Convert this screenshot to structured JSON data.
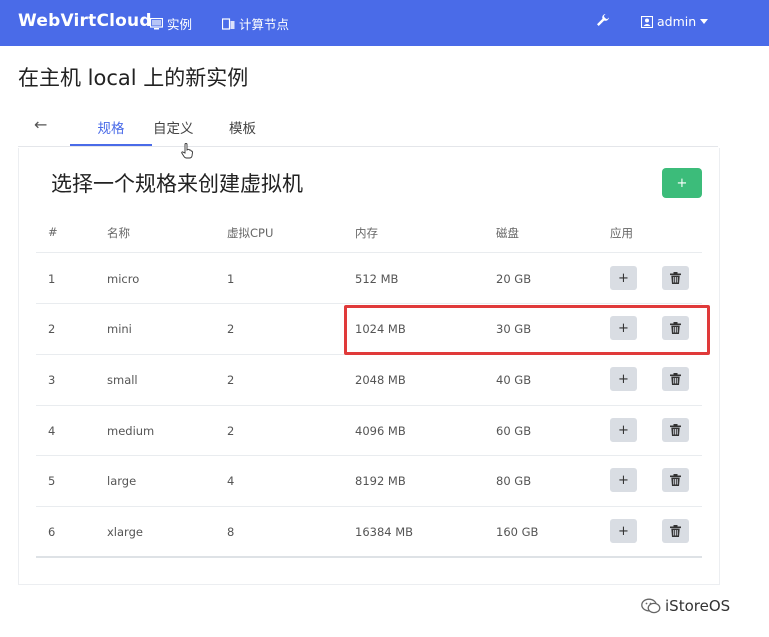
{
  "navbar": {
    "brand": "WebVirtCloud",
    "instances": "实例",
    "compute_nodes": "计算节点",
    "user": "admin"
  },
  "page_title": "在主机 local 上的新实例",
  "tabs": {
    "back": "←",
    "flavor": "规格",
    "custom": "自定义",
    "template": "模板"
  },
  "card": {
    "title": "选择一个规格来创建虚拟机",
    "add_label": "+"
  },
  "table": {
    "headers": [
      "#",
      "名称",
      "虚拟CPU",
      "内存",
      "磁盘",
      "应用"
    ],
    "rows": [
      [
        "1",
        "micro",
        "1",
        "512 MB",
        "20 GB"
      ],
      [
        "2",
        "mini",
        "2",
        "1024 MB",
        "30 GB"
      ],
      [
        "3",
        "small",
        "2",
        "2048 MB",
        "40 GB"
      ],
      [
        "4",
        "medium",
        "2",
        "4096 MB",
        "60 GB"
      ],
      [
        "5",
        "large",
        "4",
        "8192 MB",
        "80 GB"
      ],
      [
        "6",
        "xlarge",
        "8",
        "16384 MB",
        "160 GB"
      ]
    ],
    "apply_label": "+"
  },
  "watermark": "iStoreOS",
  "colors": {
    "navbar": "#4a6be8",
    "add_button": "#3cbc7a",
    "highlight": "#e03a3a"
  }
}
